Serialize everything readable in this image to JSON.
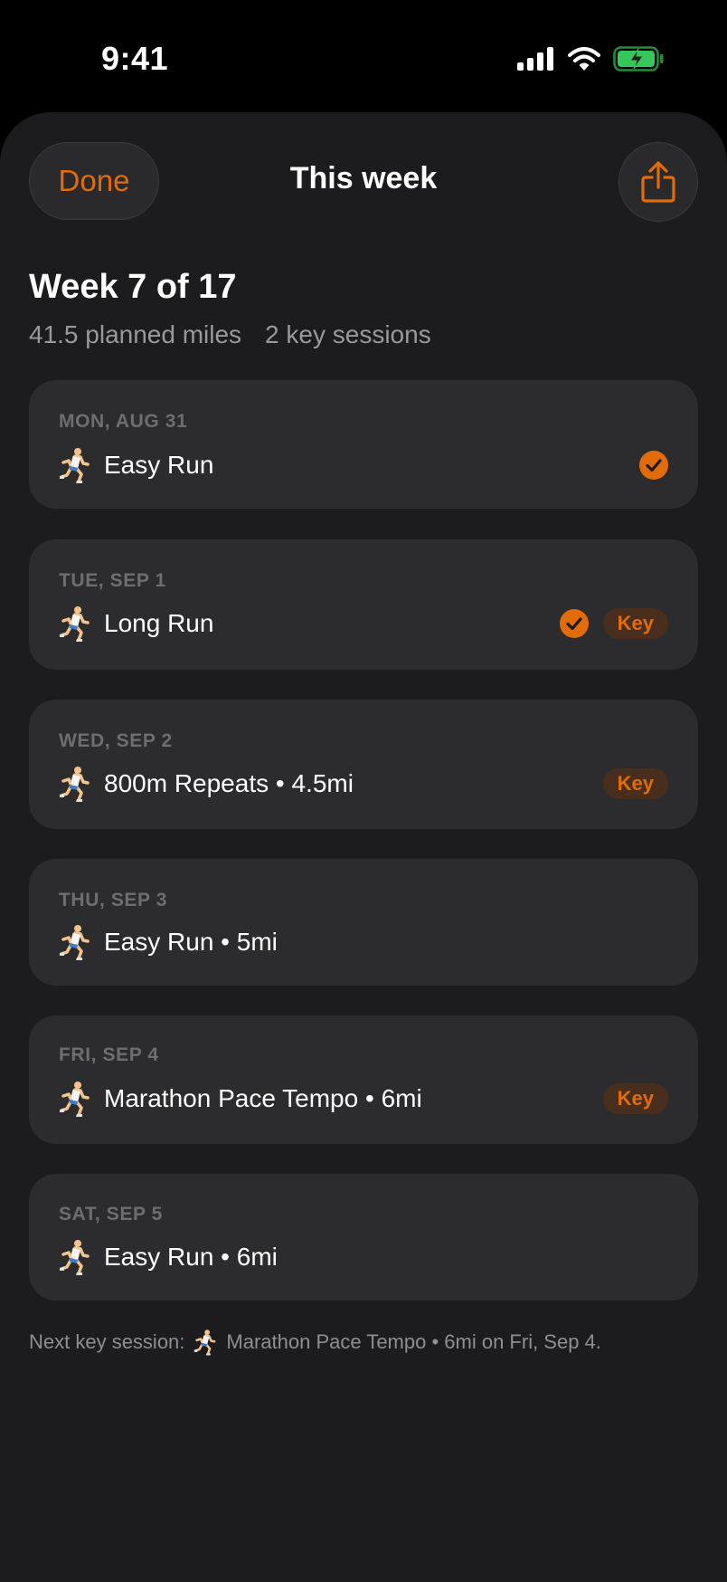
{
  "status_bar": {
    "time": "9:41"
  },
  "nav": {
    "done_label": "Done",
    "title": "This week"
  },
  "week": {
    "title": "Week 7 of 17",
    "planned_miles": "41.5 planned miles",
    "key_sessions": "2 key sessions"
  },
  "colors": {
    "accent": "#e26b0a",
    "background": "#1c1c1e",
    "card": "#2c2c2e",
    "battery_green": "#35c759"
  },
  "sessions": [
    {
      "date": "MON, AUG 31",
      "name": "Easy Run",
      "completed": true,
      "key": false
    },
    {
      "date": "TUE, SEP 1",
      "name": "Long Run",
      "completed": true,
      "key": true,
      "key_label": "Key"
    },
    {
      "date": "WED, SEP 2",
      "name": "800m Repeats • 4.5mi",
      "completed": false,
      "key": true,
      "key_label": "Key"
    },
    {
      "date": "THU, SEP 3",
      "name": "Easy Run • 5mi",
      "completed": false,
      "key": false
    },
    {
      "date": "FRI, SEP 4",
      "name": "Marathon Pace Tempo • 6mi",
      "completed": false,
      "key": true,
      "key_label": "Key"
    },
    {
      "date": "SAT, SEP 5",
      "name": "Easy Run • 6mi",
      "completed": false,
      "key": false
    }
  ],
  "footer": {
    "prefix": "Next key session:",
    "suffix": "Marathon Pace Tempo • 6mi on Fri, Sep 4."
  },
  "icons": {
    "runner": "runner-icon",
    "check": "check-circle-icon",
    "share": "share-icon"
  }
}
